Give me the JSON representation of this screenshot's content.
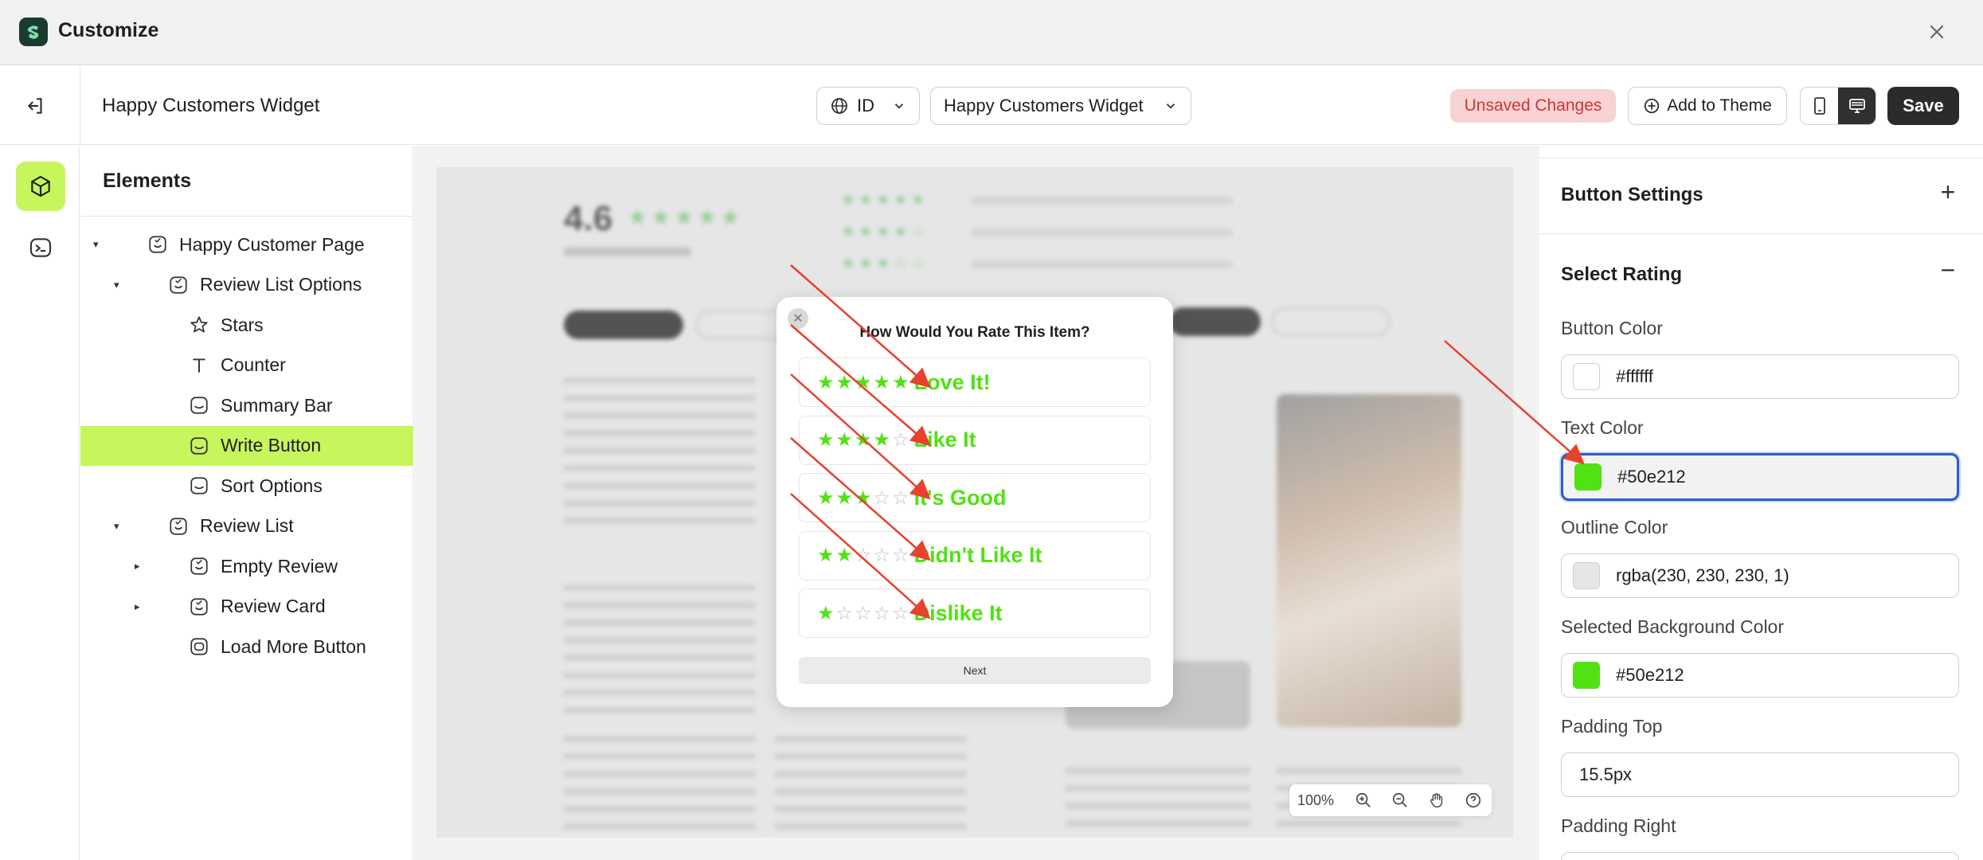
{
  "window": {
    "title": "Customize",
    "logo_icon": "shopify-app-logo",
    "close_icon": "close-icon"
  },
  "toolbar": {
    "page_name": "Happy Customers Widget",
    "language": "ID",
    "widget_select": "Happy Customers Widget",
    "unsaved_label": "Unsaved Changes",
    "add_to_theme_label": "Add to Theme",
    "save_label": "Save"
  },
  "elements": {
    "title": "Elements",
    "tree": [
      {
        "label": "Happy Customer Page",
        "icon": "section-icon",
        "level": 0,
        "caret": "down"
      },
      {
        "label": "Review List Options",
        "icon": "section-icon",
        "level": 1,
        "caret": "down"
      },
      {
        "label": "Stars",
        "icon": "star-icon",
        "level": 2,
        "caret": ""
      },
      {
        "label": "Counter",
        "icon": "text-icon",
        "level": 2,
        "caret": ""
      },
      {
        "label": "Summary Bar",
        "icon": "block-icon",
        "level": 2,
        "caret": ""
      },
      {
        "label": "Write Button",
        "icon": "block-icon",
        "level": 2,
        "caret": "",
        "active": true
      },
      {
        "label": "Sort Options",
        "icon": "block-icon",
        "level": 2,
        "caret": ""
      },
      {
        "label": "Review List",
        "icon": "section-icon",
        "level": 1,
        "caret": "down"
      },
      {
        "label": "Empty Review",
        "icon": "section-icon",
        "level": 2,
        "caret": "right"
      },
      {
        "label": "Review Card",
        "icon": "section-icon",
        "level": 2,
        "caret": "right"
      },
      {
        "label": "Load More Button",
        "icon": "button-icon",
        "level": 2,
        "caret": ""
      }
    ]
  },
  "preview": {
    "rating": "4.6",
    "modal": {
      "title": "How Would You Rate This Item?",
      "options": [
        {
          "stars": 5,
          "label": "Love It!"
        },
        {
          "stars": 4,
          "label": "Like It"
        },
        {
          "stars": 3,
          "label": "It's Good"
        },
        {
          "stars": 2,
          "label": "Didn't Like It"
        },
        {
          "stars": 1,
          "label": "Dislike It"
        }
      ],
      "next_label": "Next"
    },
    "zoom": "100%"
  },
  "settings": {
    "button_settings": {
      "title": "Button Settings",
      "toggle": "+"
    },
    "select_rating": {
      "title": "Select Rating",
      "toggle": "−",
      "fields": {
        "button_color": {
          "label": "Button Color",
          "value": "#ffffff",
          "swatch": "#ffffff"
        },
        "text_color": {
          "label": "Text Color",
          "value": "#50e212",
          "swatch": "#50e212"
        },
        "outline_color": {
          "label": "Outline Color",
          "value": "rgba(230, 230, 230, 1)",
          "swatch": "#e6e6e6"
        },
        "selected_bg_color": {
          "label": "Selected Background Color",
          "value": "#50e212",
          "swatch": "#50e212"
        },
        "padding_top": {
          "label": "Padding Top",
          "value": "15.5px"
        },
        "padding_right": {
          "label": "Padding Right"
        }
      }
    }
  },
  "colors": {
    "accent": "#c6f55c",
    "rating_text": "#50e212",
    "annotation_arrow": "#e8412c",
    "focus_border": "#2c5cc8"
  }
}
